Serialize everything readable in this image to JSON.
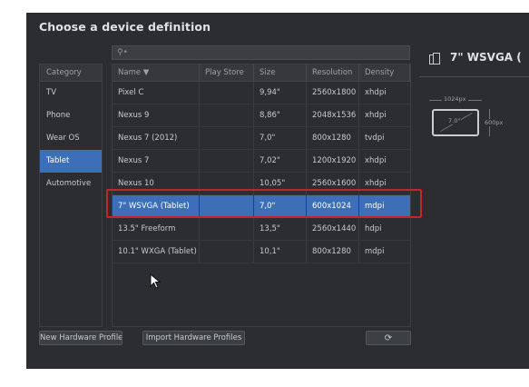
{
  "dialog": {
    "title": "Choose a device definition"
  },
  "search": {
    "icon": "search-icon",
    "placeholder": ""
  },
  "categories": {
    "header": "Category",
    "items": [
      {
        "label": "TV",
        "selected": false
      },
      {
        "label": "Phone",
        "selected": false
      },
      {
        "label": "Wear OS",
        "selected": false
      },
      {
        "label": "Tablet",
        "selected": true
      },
      {
        "label": "Automotive",
        "selected": false
      }
    ]
  },
  "table": {
    "columns": [
      "Name ▼",
      "Play Store",
      "Size",
      "Resolution",
      "Density"
    ],
    "rows": [
      {
        "name": "Pixel C",
        "play_store": "",
        "size": "9,94\"",
        "resolution": "2560x1800",
        "density": "xhdpi",
        "selected": false
      },
      {
        "name": "Nexus 9",
        "play_store": "",
        "size": "8,86\"",
        "resolution": "2048x1536",
        "density": "xhdpi",
        "selected": false
      },
      {
        "name": "Nexus 7 (2012)",
        "play_store": "",
        "size": "7,0\"",
        "resolution": "800x1280",
        "density": "tvdpi",
        "selected": false
      },
      {
        "name": "Nexus 7",
        "play_store": "",
        "size": "7,02\"",
        "resolution": "1200x1920",
        "density": "xhdpi",
        "selected": false
      },
      {
        "name": "Nexus 10",
        "play_store": "",
        "size": "10,05\"",
        "resolution": "2560x1600",
        "density": "xhdpi",
        "selected": false
      },
      {
        "name": "7\" WSVGA (Tablet)",
        "play_store": "",
        "size": "7,0\"",
        "resolution": "600x1024",
        "density": "mdpi",
        "selected": true
      },
      {
        "name": "13.5\" Freeform",
        "play_store": "",
        "size": "13,5\"",
        "resolution": "2560x1440",
        "density": "hdpi",
        "selected": false
      },
      {
        "name": "10.1\" WXGA (Tablet)",
        "play_store": "",
        "size": "10,1\"",
        "resolution": "800x1280",
        "density": "mdpi",
        "selected": false
      }
    ]
  },
  "buttons": {
    "new_hardware": "New Hardware Profile",
    "import_hardware": "Import Hardware Profiles",
    "refresh_icon": "refresh-icon"
  },
  "preview": {
    "title": "7\" WSVGA (",
    "icon": "device-icon",
    "width_label": "1024px",
    "height_label": "600px",
    "diagonal_label": "7.0\""
  },
  "colors": {
    "dialog_bg": "#2b2d30",
    "selection": "#3d6fb8",
    "highlight_border": "#c2262d"
  }
}
